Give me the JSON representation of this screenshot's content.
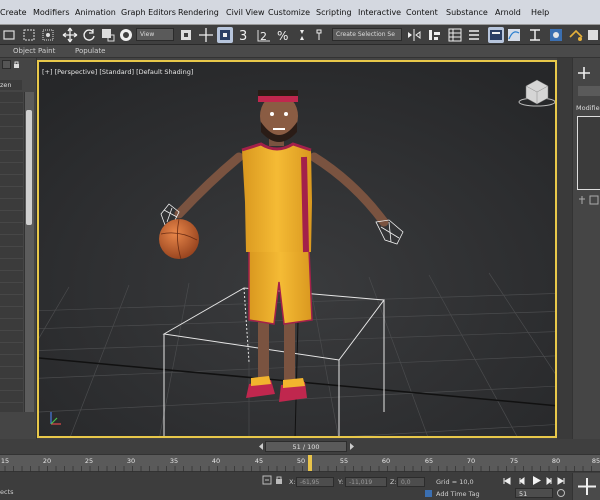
{
  "menu": {
    "items": [
      "Create",
      "Modifiers",
      "Animation",
      "Graph Editors",
      "Rendering",
      "Civil View",
      "Customize",
      "Scripting",
      "Interactive",
      "Content",
      "Substance",
      "Arnold",
      "Help"
    ]
  },
  "toolbar": {
    "view_select": "View",
    "selection_set": "Create Selection Se",
    "snap_label": "3",
    "angle_snap_label": "2",
    "percent_label": "%"
  },
  "ribbon": {
    "tabs": [
      "Object Paint",
      "Populate"
    ]
  },
  "left_panel": {
    "label": "zen"
  },
  "viewport": {
    "label": "[+] [Perspective] [Standard] [Default Shading]"
  },
  "right_panel": {
    "modifier_label": "Modifie"
  },
  "timeline": {
    "frame_display": "51 / 100",
    "ticks": [
      "15",
      "20",
      "25",
      "30",
      "35",
      "40",
      "45",
      "50",
      "55",
      "60",
      "65",
      "70",
      "75",
      "80",
      "85",
      "90",
      "95"
    ],
    "current_frame": 51
  },
  "status": {
    "left_text": "ects",
    "x_label": "X:",
    "x_value": "-61,95",
    "y_label": "Y:",
    "y_value": "-11,019",
    "z_label": "Z:",
    "z_value": "0,0",
    "grid_text": "Grid = 10,0",
    "add_time_tag": "Add Time Tag",
    "frame_field": "51"
  },
  "colors": {
    "viewport_border": "#e8c84a",
    "jersey": "#f0b52e",
    "jersey_trim": "#a3204a",
    "skin": "#7a5340",
    "ball": "#c8622b"
  }
}
